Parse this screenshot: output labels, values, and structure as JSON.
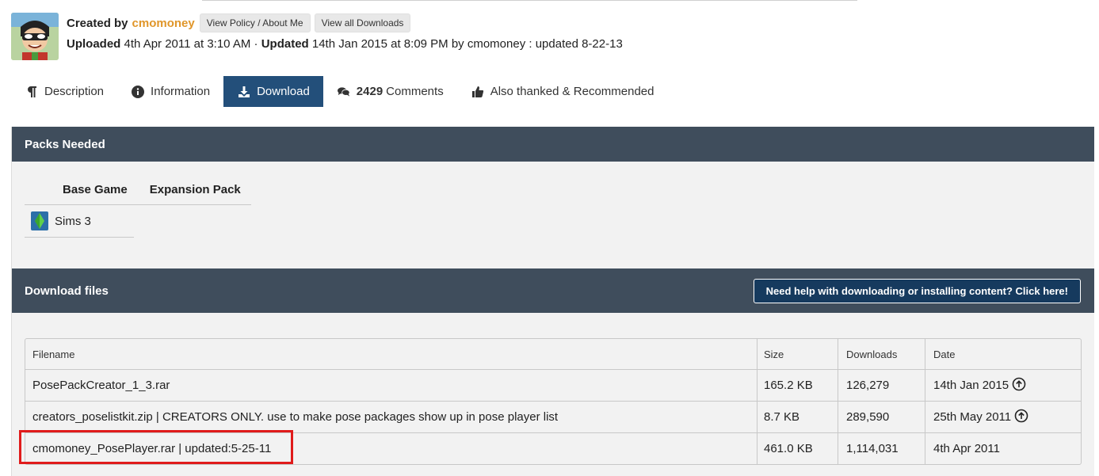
{
  "header": {
    "created_label": "Created by",
    "creator": "cmomoney",
    "chips": [
      "View Policy / About Me",
      "View all Downloads"
    ],
    "uploaded_label": "Uploaded",
    "uploaded_value": "4th Apr 2011 at 3:10 AM",
    "separator": "·",
    "updated_label": "Updated",
    "updated_value": "14th Jan 2015 at 8:09 PM by cmomoney : updated 8-22-13"
  },
  "tabs": [
    {
      "label": "Description",
      "icon": "paragraph-icon"
    },
    {
      "label": "Information",
      "icon": "info-icon"
    },
    {
      "label": "Download",
      "icon": "download-icon",
      "active": true
    },
    {
      "count": "2429",
      "label": "Comments",
      "icon": "comments-icon"
    },
    {
      "label": "Also thanked & Recommended",
      "icon": "thumbs-up-icon"
    }
  ],
  "packs": {
    "title": "Packs Needed",
    "col_base": "Base Game",
    "col_expansion": "Expansion Pack",
    "base_game": "Sims 3"
  },
  "downloads": {
    "title": "Download files",
    "help_button": "Need help with downloading or installing content? Click here!",
    "columns": [
      "Filename",
      "Size",
      "Downloads",
      "Date"
    ],
    "rows": [
      {
        "filename": "PosePackCreator_1_3.rar",
        "size": "165.2 KB",
        "downloads": "126,279",
        "date": "14th Jan 2015",
        "updated_icon": true
      },
      {
        "filename": "creators_poselistkit.zip | CREATORS ONLY. use to make pose packages show up in pose player list",
        "size": "8.7 KB",
        "downloads": "289,590",
        "date": "25th May 2011",
        "updated_icon": true
      },
      {
        "filename": "cmomoney_PosePlayer.rar | updated:5-25-11",
        "size": "461.0 KB",
        "downloads": "1,114,031",
        "date": "4th Apr 2011",
        "updated_icon": false
      }
    ]
  },
  "colors": {
    "tab_active": "#234f7a",
    "section_bar": "#3f4d5c",
    "creator_link": "#e0962a",
    "highlight": "#e01b1b"
  }
}
